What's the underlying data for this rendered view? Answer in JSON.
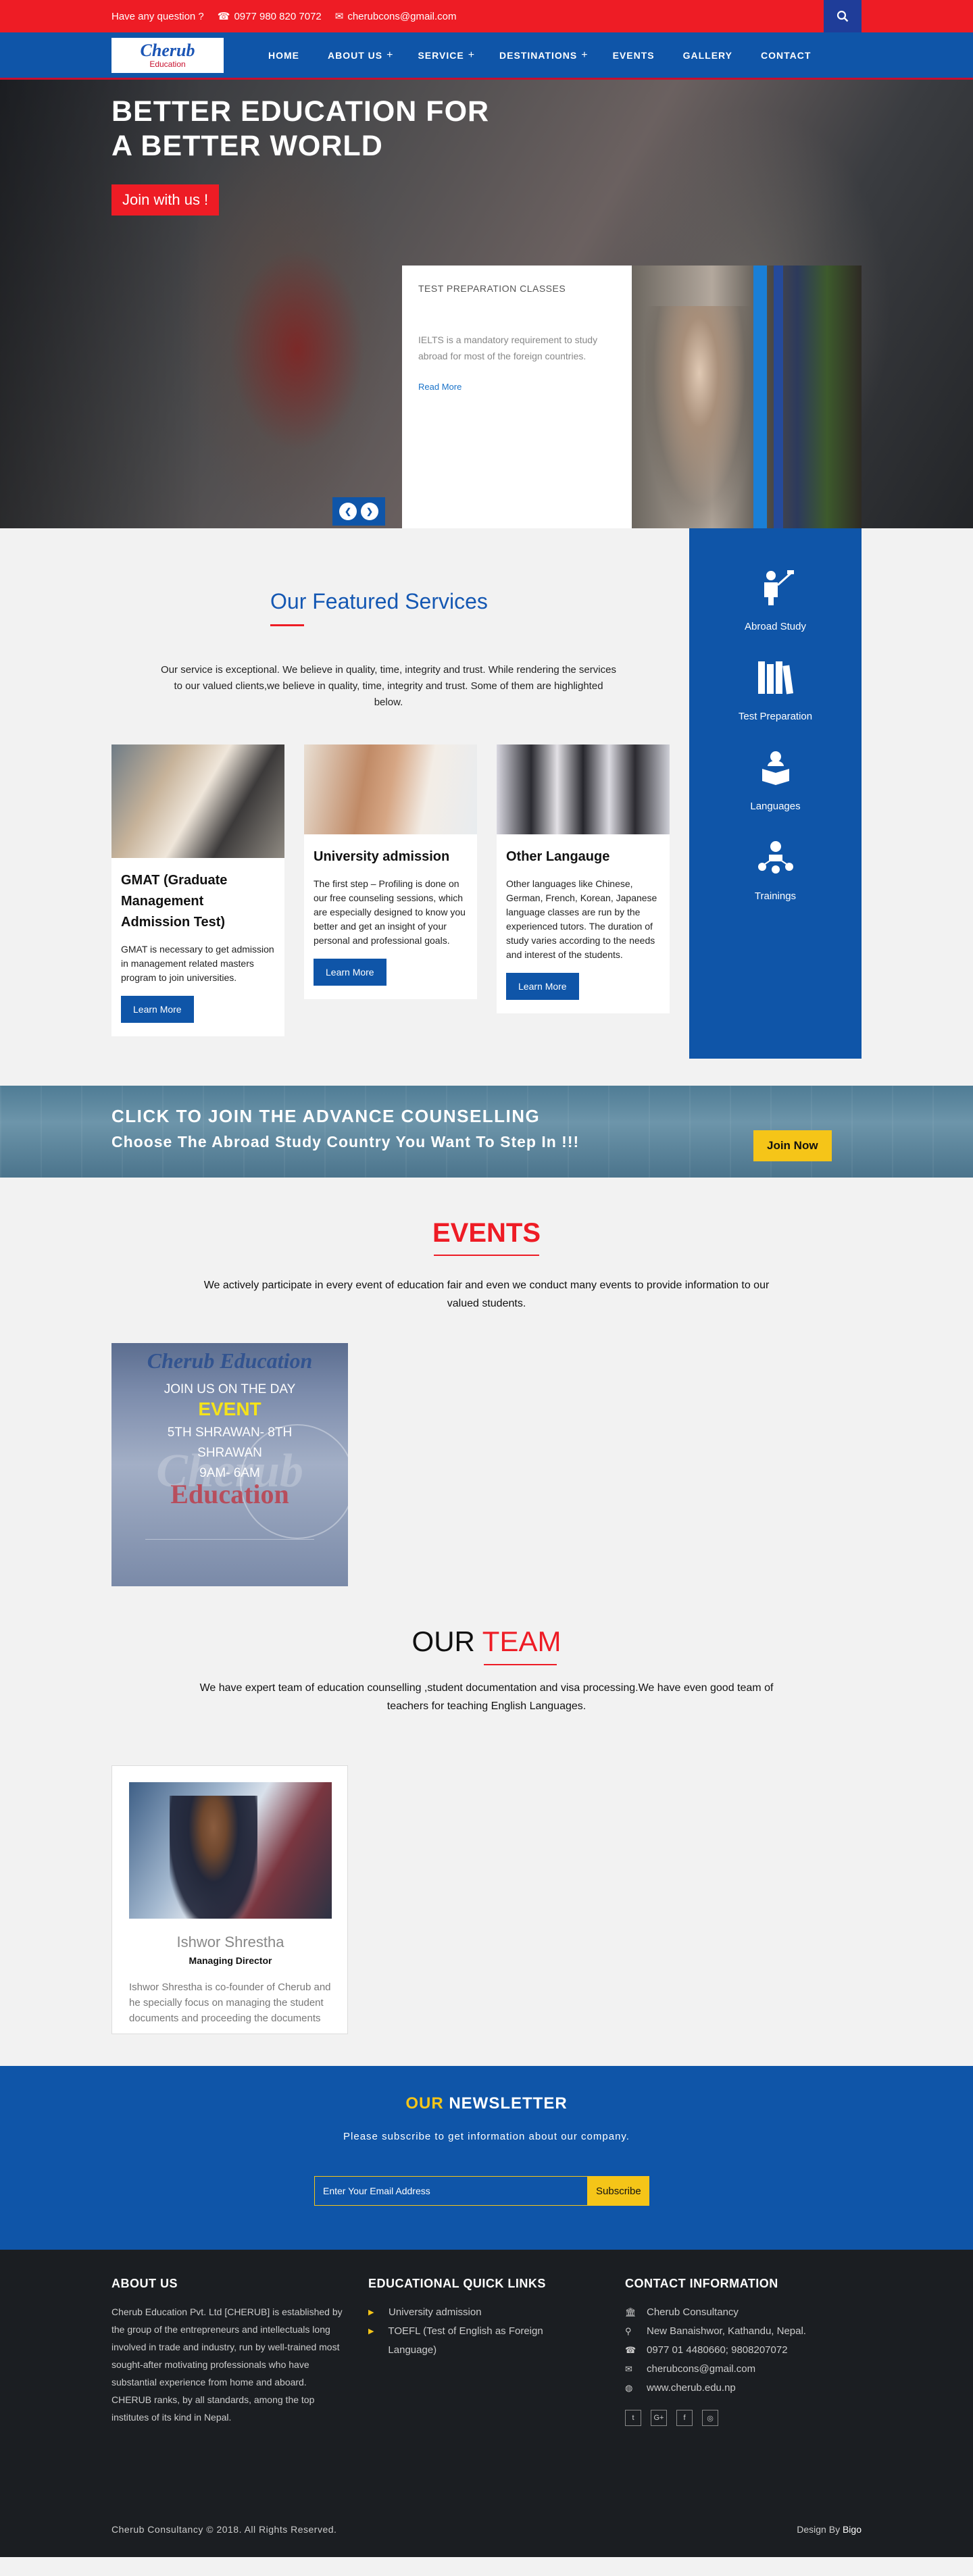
{
  "topbar": {
    "question": "Have any question ?",
    "phone": "0977 980 820 7072",
    "email": "cherubcons@gmail.com"
  },
  "logo": {
    "line1": "Cherub",
    "line2": "Education"
  },
  "nav": [
    {
      "label": "HOME",
      "plus": ""
    },
    {
      "label": "ABOUT US",
      "plus": "+"
    },
    {
      "label": "SERVICE",
      "plus": "+"
    },
    {
      "label": "DESTINATIONS",
      "plus": "+"
    },
    {
      "label": "EVENTS",
      "plus": ""
    },
    {
      "label": "GALLERY",
      "plus": ""
    },
    {
      "label": "CONTACT",
      "plus": ""
    }
  ],
  "hero": {
    "line1": "BETTER EDUCATION FOR",
    "line2": "A BETTER WORLD",
    "join": "Join with us !",
    "card_title": "TEST PREPARATION CLASSES",
    "card_desc": "IELTS is a mandatory requirement to study abroad for most of the foreign countries.",
    "card_link": "Read More"
  },
  "services": {
    "title": "Our Featured Services",
    "intro": "Our service is exceptional. We believe in quality, time, integrity and trust. While rendering the services to our valued clients,we believe in quality, time, integrity and trust. Some of them are highlighted below.",
    "cards": [
      {
        "title": "GMAT (Graduate Management Admission Test)",
        "desc": "GMAT is necessary to get admission in management related masters program to join universities.",
        "button": "Learn More"
      },
      {
        "title": "University admission",
        "desc": "The first step – Profiling is done on our free counseling sessions, which are especially designed to know you better and get an insight of your personal and professional goals.",
        "button": "Learn More"
      },
      {
        "title": "Other Langauge",
        "desc": "Other languages like Chinese, German, French, Korean, Japanese language classes  are run by the experienced tutors. The duration of study varies according to the needs and interest of the students.",
        "button": "Learn More"
      }
    ],
    "sidebar": [
      {
        "label": "Abroad Study",
        "icon": "teacher-icon"
      },
      {
        "label": "Test Preparation",
        "icon": "books-icon"
      },
      {
        "label": "Languages",
        "icon": "reading-icon"
      },
      {
        "label": "Trainings",
        "icon": "training-icon"
      }
    ]
  },
  "counsel": {
    "line1": "CLICK TO JOIN THE ADVANCE COUNSELLING",
    "line2": "Choose The Abroad Study Country You Want To Step In !!!",
    "button": "Join Now"
  },
  "events": {
    "title": "EVENTS",
    "intro": "We actively participate in every event of education fair and even we conduct many events to provide information to our valued students.",
    "poster": {
      "logo": "Cherub Education",
      "join": "JOIN US ON THE DAY",
      "event": "EVENT",
      "date1": "5TH SHRAWAN- 8TH",
      "date2": "SHRAWAN",
      "time": "9AM- 6AM",
      "bg1": "Cherub",
      "bg2": "Education"
    }
  },
  "team": {
    "title_a": "OUR",
    "title_b": "TEAM",
    "intro": "We have expert team of education counselling ,student documentation and visa processing.We have even good team of teachers for teaching English Languages.",
    "member": {
      "name": "Ishwor Shrestha",
      "role": "Managing Director",
      "desc": "Ishwor Shrestha is co-founder of Cherub and he specially focus on managing the student documents and proceeding the documents to"
    }
  },
  "newsletter": {
    "title_a": "OUR",
    "title_b": "NEWSLETTER",
    "sub": "Please subscribe to get information about our company.",
    "placeholder": "Enter Your Email Address",
    "button": "Subscribe"
  },
  "footer": {
    "about_title": "ABOUT US",
    "about_text": "Cherub Education Pvt. Ltd [CHERUB] is established by the group of the entrepreneurs and intellectuals long involved in trade and industry, run by well-trained most sought-after motivating professionals who have substantial experience from home and aboard. CHERUB ranks, by all standards, among the top institutes of its kind in Nepal.",
    "links_title": "EDUCATIONAL QUICK LINKS",
    "links": [
      "University admission",
      "TOEFL (Test of English as Foreign Language)"
    ],
    "contact_title": "CONTACT INFORMATION",
    "contact": [
      {
        "icon": "building-icon",
        "text": "Cherub Consultancy"
      },
      {
        "icon": "location-icon",
        "text": "New Banaishwor, Kathandu, Nepal."
      },
      {
        "icon": "phone-icon",
        "text": "0977 01 4480660; 9808207072"
      },
      {
        "icon": "email-icon",
        "text": "cherubcons@gmail.com"
      },
      {
        "icon": "globe-icon",
        "text": "www.cherub.edu.np"
      }
    ],
    "copyright": "Cherub Consultancy © 2018. All Rights Reserved.",
    "design": "Design By",
    "designer": "Bigo"
  },
  "colors": {
    "red": "#ee1c25",
    "blue": "#0f55a8",
    "yellow": "#f5c518",
    "dark": "#1b1e22"
  }
}
